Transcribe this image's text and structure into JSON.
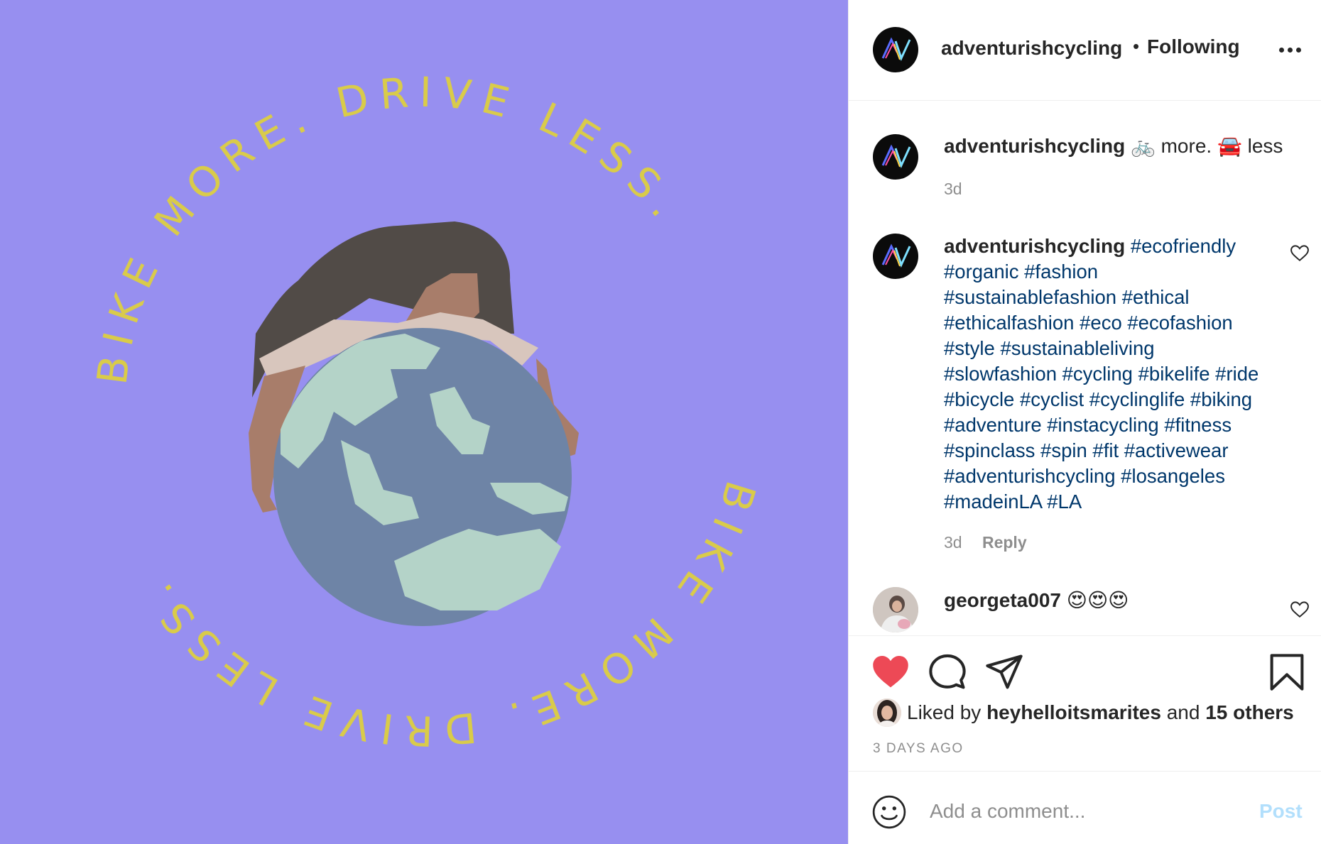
{
  "post": {
    "author": "adventurishcycling",
    "follow_status": "Following",
    "separator": "•",
    "image": {
      "ring_text_top": "BIKE MORE. DRIVE LESS.",
      "ring_text_bottom": "BIKE MORE. DRIVE LESS.",
      "background_color": "#978ff0",
      "text_color": "#d9cb4a"
    }
  },
  "caption": {
    "username": "adventurishcycling",
    "text": "🚲 more. 🚘 less",
    "time": "3d"
  },
  "hashtag_comment": {
    "username": "adventurishcycling",
    "hashtags": "#ecofriendly #organic #fashion #sustainablefashion #ethical #ethicalfashion #eco #ecofashion #style #sustainableliving #slowfashion #cycling #bikelife #ride #bicycle #cyclist #cyclinglife #biking #adventure #instacycling #fitness #spinclass #spin #fit #activewear #adventurishcycling #losangeles #madeinLA #LA",
    "time": "3d",
    "reply_label": "Reply"
  },
  "comment3": {
    "username": "georgeta007",
    "text": "😍😍😍"
  },
  "likes": {
    "prefix": "Liked by",
    "liker": "heyhelloitsmarites",
    "and": "and",
    "others": "15 others"
  },
  "posted_ago": "3 DAYS AGO",
  "add_comment": {
    "placeholder": "Add a comment...",
    "post_label": "Post"
  },
  "colors": {
    "like_red": "#ed4956",
    "hashtag_blue": "#00376b",
    "post_disabled": "#b2dffc"
  }
}
